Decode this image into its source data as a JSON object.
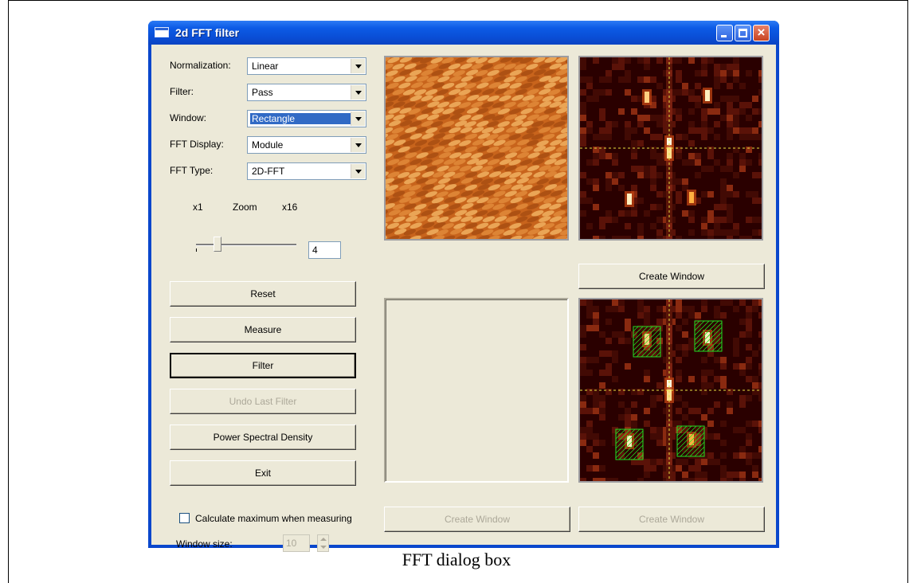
{
  "window": {
    "title": "2d FFT filter"
  },
  "settings": [
    {
      "label": "Normalization:",
      "value": "Linear",
      "selected": false
    },
    {
      "label": "Filter:",
      "value": "Pass",
      "selected": false
    },
    {
      "label": "Window:",
      "value": "Rectangle",
      "selected": true
    },
    {
      "label": "FFT Display:",
      "value": "Module",
      "selected": false
    },
    {
      "label": "FFT Type:",
      "value": "2D-FFT",
      "selected": false
    }
  ],
  "zoom": {
    "min_label": "x1",
    "label": "Zoom",
    "max_label": "x16",
    "value": "4",
    "level": 4
  },
  "buttons": {
    "reset": "Reset",
    "measure": "Measure",
    "filter": "Filter",
    "undo": "Undo Last Filter",
    "psd": "Power Spectral Density",
    "exit": "Exit"
  },
  "measure_options": {
    "calc_max_label": "Calculate maximum when measuring",
    "calc_max_checked": false,
    "window_size_label": "Window size:",
    "window_size_value": "10"
  },
  "create_window": {
    "top_right": "Create Window",
    "bottom_left": "Create Window",
    "bottom_right": "Create Window"
  },
  "caption": "FFT dialog box",
  "colors": {
    "titlebar": "#0a4ed6",
    "client": "#ece9d8",
    "fft_bg": "#2a0000",
    "filter_box": "#22e022",
    "crosshair": "#e8e040"
  }
}
